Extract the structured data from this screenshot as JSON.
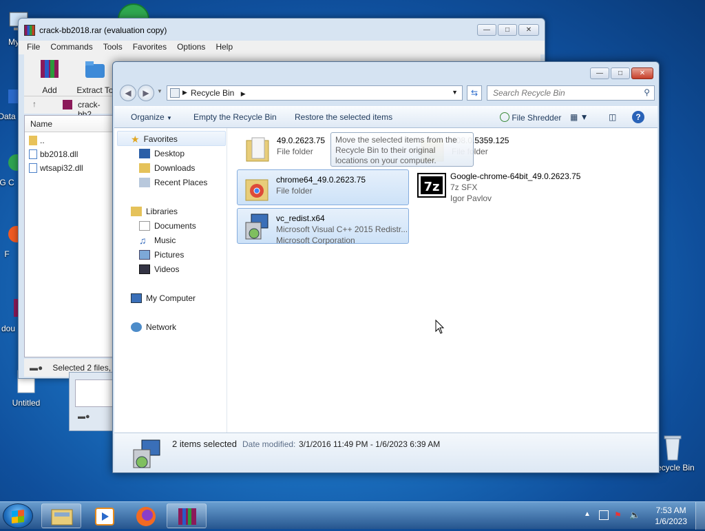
{
  "desktop": {
    "icons": [
      {
        "label": "My C"
      },
      {
        "label": "Data"
      },
      {
        "label": "G C"
      },
      {
        "label": "F"
      },
      {
        "label": "dou"
      },
      {
        "label": "Untitled"
      },
      {
        "label": "Recycle Bin"
      }
    ]
  },
  "winrar": {
    "title": "crack-bb2018.rar (evaluation copy)",
    "menu": [
      "File",
      "Commands",
      "Tools",
      "Favorites",
      "Options",
      "Help"
    ],
    "tools": [
      {
        "label": "Add"
      },
      {
        "label": "Extract To"
      }
    ],
    "path": "crack-bb2",
    "column_name": "Name",
    "files": [
      {
        "name": ".."
      },
      {
        "name": "bb2018.dll"
      },
      {
        "name": "wtsapi32.dll"
      }
    ],
    "status": "Selected 2 files, ..."
  },
  "explorer": {
    "address_segment": "Recycle Bin",
    "search_placeholder": "Search Recycle Bin",
    "commands": {
      "organize": "Organize",
      "empty": "Empty the Recycle Bin",
      "restore": "Restore the selected items",
      "shredder": "File Shredder"
    },
    "nav": {
      "favorites": "Favorites",
      "desktop": "Desktop",
      "downloads": "Downloads",
      "recent": "Recent Places",
      "libraries": "Libraries",
      "documents": "Documents",
      "music": "Music",
      "pictures": "Pictures",
      "videos": "Videos",
      "computer": "My Computer",
      "network": "Network"
    },
    "items": [
      {
        "name": "49.0.2623.75",
        "line2": "File folder",
        "line3": "",
        "selected": false
      },
      {
        "name": "108.0.5359.125",
        "line2": "File folder",
        "line3": "",
        "selected": false
      },
      {
        "name": "chrome64_49.0.2623.75",
        "line2": "File folder",
        "line3": "",
        "selected": true
      },
      {
        "name": "Google-chrome-64bit_49.0.2623.75",
        "line2": "7z SFX",
        "line3": "Igor Pavlov",
        "selected": false
      },
      {
        "name": "vc_redist.x64",
        "line2": "Microsoft Visual C++ 2015 Redistr...",
        "line3": "Microsoft Corporation",
        "selected": true
      }
    ],
    "tooltip": "Move the selected items from the Recycle Bin to their original locations on your computer.",
    "details": {
      "count": "2 items selected",
      "date_label": "Date modified:",
      "date_value": "3/1/2016 11:49 PM - 1/6/2023 6:39 AM"
    }
  },
  "taskbar": {
    "time": "7:53 AM",
    "date": "1/6/2023"
  }
}
